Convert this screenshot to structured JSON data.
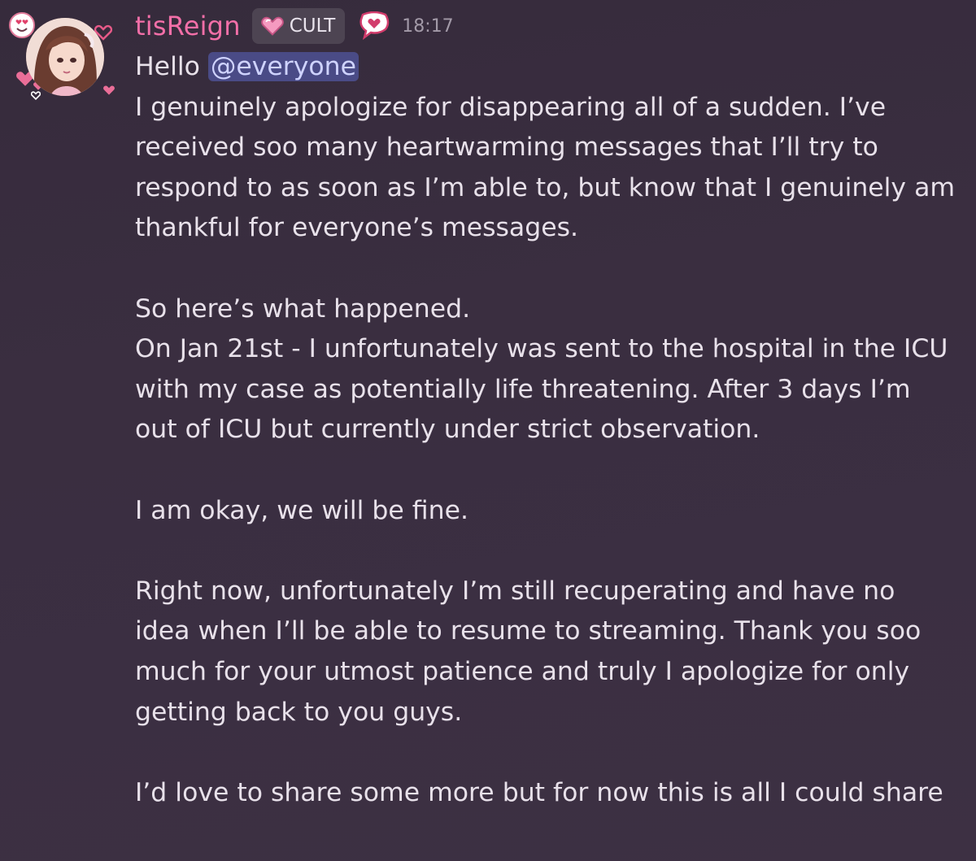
{
  "author": {
    "username": "tisReign",
    "role_badge": "CULT",
    "timestamp": "18:17",
    "avatar_icon": "anime-girl-avatar",
    "status_icon": "heart-speech-bubble-icon"
  },
  "message": {
    "greeting": "Hello",
    "mention": "@everyone",
    "paragraphs": [
      "I genuinely apologize for disappearing all of a sudden. I’ve received soo many heartwarming messages that I’ll try to respond to as soon as I’m able to, but know that I genuinely am thankful for everyone’s messages.",
      "So here’s what happened.",
      "On Jan 21st - I unfortunately was sent to the hospital in the ICU with my case as potentially life threatening. After 3 days I’m out of ICU but currently under strict observation.",
      "I am okay, we will be fine.",
      "Right now, unfortunately I’m still recuperating and have no idea when I’ll be able to resume to streaming. Thank you soo much for your utmost patience and truly I apologize for only getting back to you guys.",
      "I’d love to share some more but for now this is all I could share"
    ]
  },
  "colors": {
    "username": "#f36fa8",
    "mention_bg": "#4a4b86",
    "background": "#3a2e40"
  }
}
